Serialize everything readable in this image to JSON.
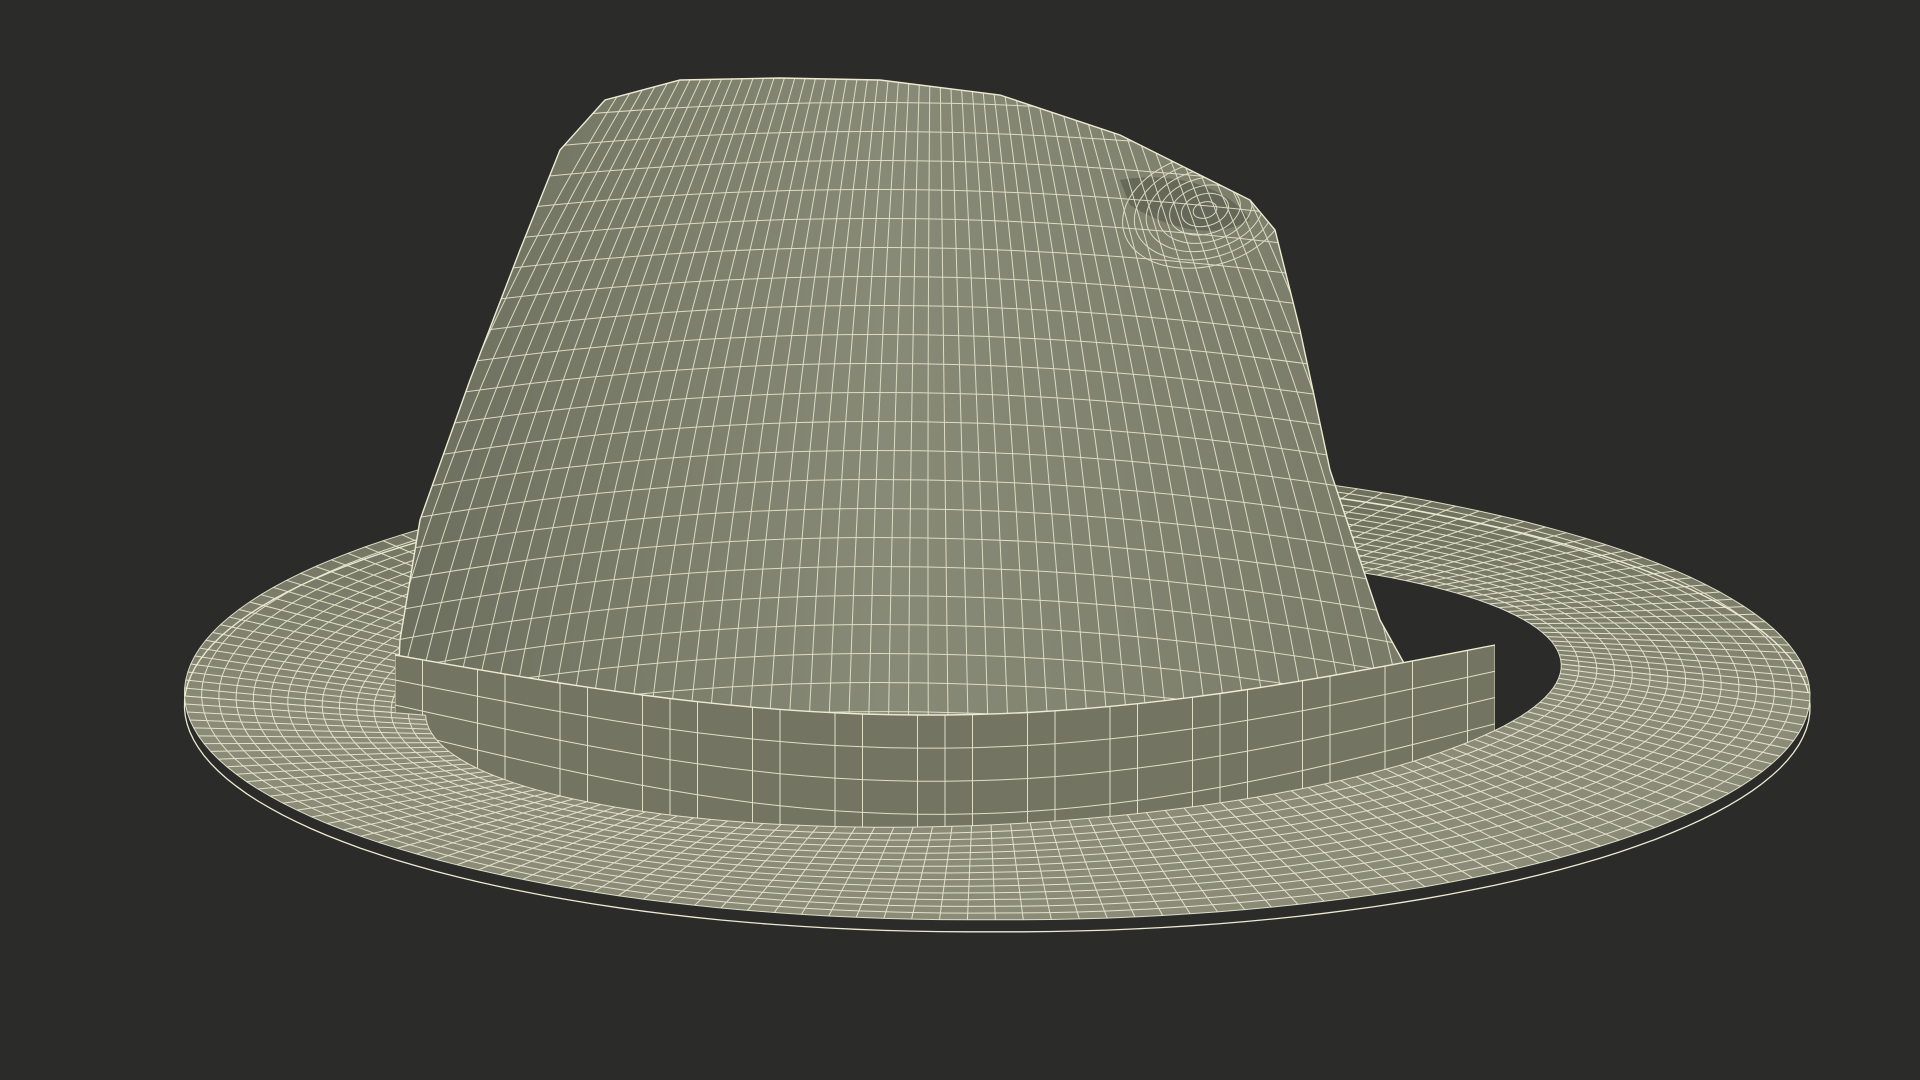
{
  "scene": {
    "subject": "fedora-hat-wireframe",
    "colors": {
      "background": "#2b2b29",
      "surface_light": "#8a8c78",
      "surface_mid": "#7a7c69",
      "surface_dark": "#5f6152",
      "band": "#737562",
      "wire": "#ecebd2"
    },
    "mesh": {
      "crown_rings": 26,
      "crown_segments": 60,
      "band_segments": 28,
      "brim_rings": 14,
      "brim_segments": 90
    }
  }
}
